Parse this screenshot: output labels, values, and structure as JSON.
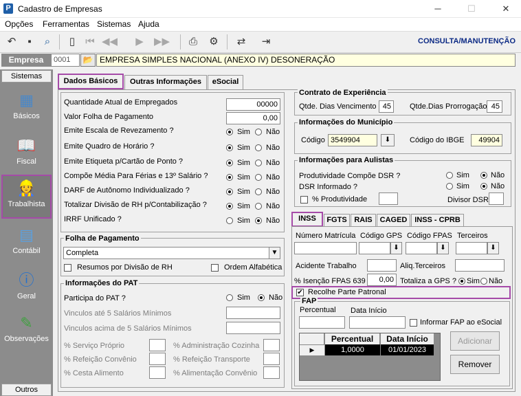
{
  "window": {
    "title": "Cadastro de Empresas",
    "app_icon": "P"
  },
  "menu": [
    "Opções",
    "Ferramentas",
    "Sistemas",
    "Ajuda"
  ],
  "mode_label": "CONSULTA/MANUTENÇÃO",
  "empresa": {
    "label": "Empresa",
    "code": "0001",
    "name": "EMPRESA SIMPLES NACIONAL (ANEXO IV) DESONERAÇÃO"
  },
  "sidebar": {
    "header": "Sistemas",
    "footer": "Outros",
    "items": [
      {
        "label": "Básicos"
      },
      {
        "label": "Fiscal"
      },
      {
        "label": "Trabalhista"
      },
      {
        "label": "Contábil"
      },
      {
        "label": "Geral"
      },
      {
        "label": "Observações"
      }
    ]
  },
  "tabs": [
    "Dados Básicos",
    "Outras Informações",
    "eSocial"
  ],
  "radio_labels": {
    "sim": "Sim",
    "nao": "Não"
  },
  "basic": {
    "qtd_label": "Quantidade Atual de Empregados",
    "qtd_value": "00000",
    "folha_label": "Valor Folha de Pagamento",
    "folha_value": "0,00",
    "questions": [
      {
        "label": "Emite Escala de Revezamento ?",
        "value": "Sim"
      },
      {
        "label": "Emite Quadro de Horário ?",
        "value": "Sim"
      },
      {
        "label": "Emite Etiqueta p/Cartão de Ponto ?",
        "value": "Sim"
      },
      {
        "label": "Compõe Média Para Férias e 13º Salário ?",
        "value": "Sim"
      },
      {
        "label": "DARF de Autônomo Individualizado ?",
        "value": "Sim"
      },
      {
        "label": "Totalizar Divisão de RH p/Contabilização ?",
        "value": "Sim"
      },
      {
        "label": "IRRF Unificado ?",
        "value": "Não"
      }
    ]
  },
  "folha_pagamento": {
    "title": "Folha de Pagamento",
    "selected": "Completa",
    "resumos_label": "Resumos por Divisão de RH",
    "ordem_label": "Ordem Alfabética"
  },
  "pat": {
    "title": "Informações do PAT",
    "participa_label": "Participa do PAT ?",
    "participa_value": "Não",
    "vinculos_ate": "Vinculos até 5 Salários Mínimos",
    "vinculos_acima": "Vinculos acima de 5 Salários Mínimos",
    "pct_left": [
      "% Serviço Próprio",
      "% Refeição Convênio",
      "% Cesta Alimento"
    ],
    "pct_right": [
      "% Administração Cozinha",
      "% Refeição Transporte",
      "% Alimentação Convênio"
    ]
  },
  "contrato": {
    "title": "Contrato de Experiência",
    "venc_label": "Qtde. Dias Vencimento",
    "venc_value": "45",
    "prorr_label": "Qtde.Dias Prorrogação",
    "prorr_value": "45"
  },
  "municipio": {
    "title": "Informações do Município",
    "codigo_label": "Código",
    "codigo_value": "3549904",
    "ibge_label": "Código do IBGE",
    "ibge_value": "49904"
  },
  "aulistas": {
    "title": "Informações para Aulistas",
    "produtividade_label": "Produtividade Compõe DSR ?",
    "produtividade_value": "Não",
    "dsr_label": "DSR Informado ?",
    "dsr_value": "Não",
    "pct_produtividade": "% Produtividade",
    "divisor_dsr": "Divisor DSR"
  },
  "inner_tabs": [
    "INSS",
    "FGTS",
    "RAIS",
    "CAGED",
    "INSS - CPRB"
  ],
  "inss": {
    "matricula_label": "Número Matrícula",
    "gps_label": "Código GPS",
    "fpas_label": "Código FPAS",
    "terceiros_label": "Terceiros",
    "acidente_label": "Acidente Trabalho",
    "aliq_label": "Aliq.Terceiros",
    "isencao_label": "% Isenção FPAS 639",
    "isencao_value": "0,00",
    "totaliza_label": "Totaliza a GPS ?",
    "totaliza_value": "Sim",
    "recolhe_label": "Recolhe Parte Patronal",
    "recolhe_checked": true
  },
  "fap": {
    "title": "FAP",
    "percentual_label": "Percentual",
    "data_label": "Data Início",
    "informar_label": "Informar FAP ao eSocial",
    "grid_headers": [
      "Percentual",
      "Data Início"
    ],
    "grid_rows": [
      {
        "percentual": "1,0000",
        "data": "01/01/2023"
      }
    ],
    "btn_adicionar": "Adicionar",
    "btn_remover": "Remover"
  }
}
